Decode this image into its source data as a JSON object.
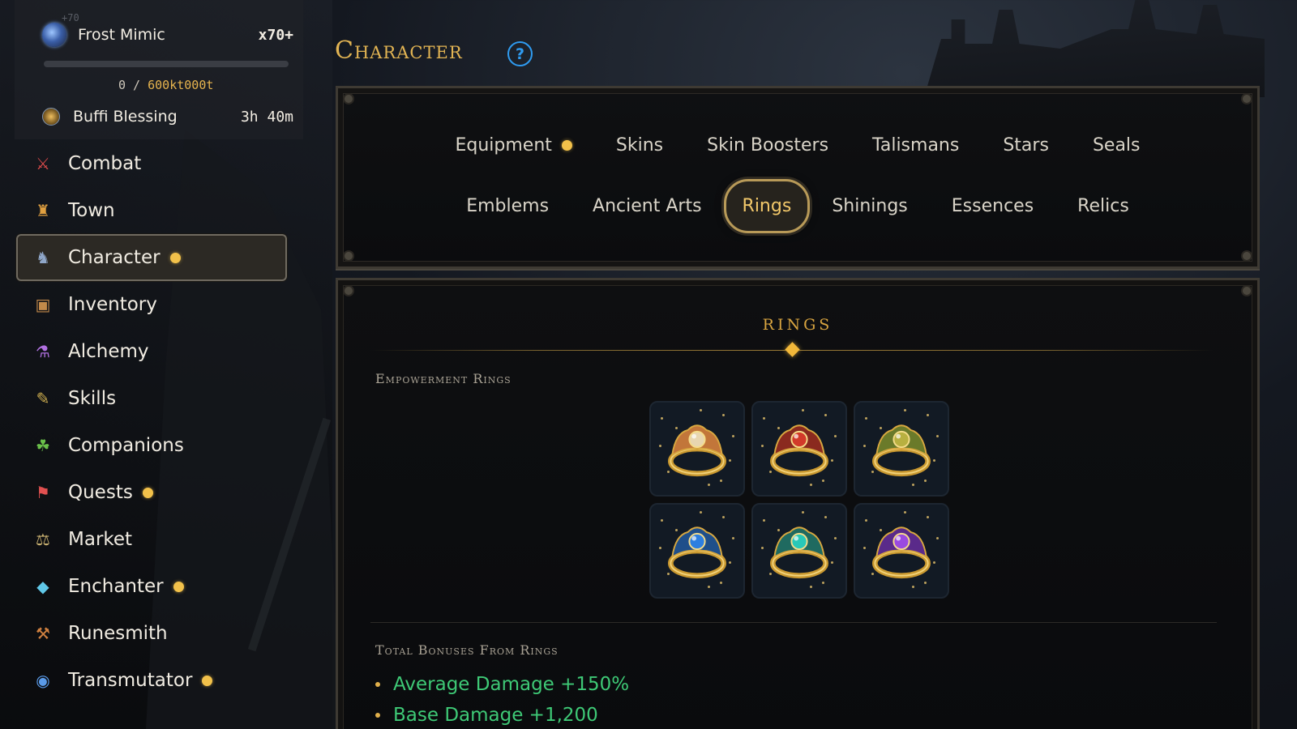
{
  "boss": {
    "level": "+70",
    "name": "Frost Mimic",
    "multiplier": "x70+",
    "progress_current": "0",
    "progress_separator": " / ",
    "progress_max": "600kt000t",
    "progress_fraction": 0.0
  },
  "blessing": {
    "label": "Buffi Blessing",
    "time": "3h 40m"
  },
  "nav": [
    {
      "label": "Combat",
      "icon": "crossed-swords-icon",
      "badge": false
    },
    {
      "label": "Town",
      "icon": "castle-icon",
      "badge": false
    },
    {
      "label": "Character",
      "icon": "knight-icon",
      "badge": true,
      "active": true
    },
    {
      "label": "Inventory",
      "icon": "backpack-icon",
      "badge": false
    },
    {
      "label": "Alchemy",
      "icon": "potion-icon",
      "badge": false
    },
    {
      "label": "Skills",
      "icon": "scroll-icon",
      "badge": false
    },
    {
      "label": "Companions",
      "icon": "paw-icon",
      "badge": false
    },
    {
      "label": "Quests",
      "icon": "quest-scroll-icon",
      "badge": true
    },
    {
      "label": "Market",
      "icon": "scales-icon",
      "badge": false
    },
    {
      "label": "Enchanter",
      "icon": "crystal-icon",
      "badge": true
    },
    {
      "label": "Runesmith",
      "icon": "hammer-icon",
      "badge": false
    },
    {
      "label": "Transmutator",
      "icon": "swirl-orb-icon",
      "badge": true
    }
  ],
  "header": {
    "title": "Character",
    "help_icon": "question-circle-icon"
  },
  "tabs": {
    "row1": [
      {
        "label": "Equipment",
        "badge": true
      },
      {
        "label": "Skins",
        "badge": false
      },
      {
        "label": "Skin Boosters",
        "badge": false
      },
      {
        "label": "Talismans",
        "badge": false
      },
      {
        "label": "Stars",
        "badge": false
      },
      {
        "label": "Seals",
        "badge": false
      }
    ],
    "row2": [
      {
        "label": "Emblems",
        "badge": false
      },
      {
        "label": "Ancient Arts",
        "badge": false
      },
      {
        "label": "Rings",
        "badge": false,
        "active": true
      },
      {
        "label": "Shinings",
        "badge": false
      },
      {
        "label": "Essences",
        "badge": false
      },
      {
        "label": "Relics",
        "badge": false
      }
    ]
  },
  "rings_section": {
    "title": "RINGS",
    "empowerment_heading": "Empowerment Rings",
    "rings": [
      {
        "name": "shell-ring-icon",
        "gem": "#e8d6b0",
        "accent": "#c2763a"
      },
      {
        "name": "ruby-crown-ring-icon",
        "gem": "#d23a2a",
        "accent": "#8a2a1f"
      },
      {
        "name": "lion-ring-icon",
        "gem": "#b8b040",
        "accent": "#6a7a2a"
      },
      {
        "name": "sapphire-ring-icon",
        "gem": "#2d7fe0",
        "accent": "#1f4f8a"
      },
      {
        "name": "dragon-turquoise-ring-icon",
        "gem": "#28c8b8",
        "accent": "#1f6a60"
      },
      {
        "name": "amethyst-ring-icon",
        "gem": "#9a4ae0",
        "accent": "#5a2a8a"
      }
    ],
    "bonuses_heading": "Total Bonuses From Rings",
    "bonuses": [
      "Average Damage +150%",
      "Base Damage +1,200"
    ]
  },
  "colors": {
    "gold": "#e2b453",
    "badge": "#f2c14a",
    "bonus_green": "#3ec976",
    "help_blue": "#2f9bf0"
  }
}
